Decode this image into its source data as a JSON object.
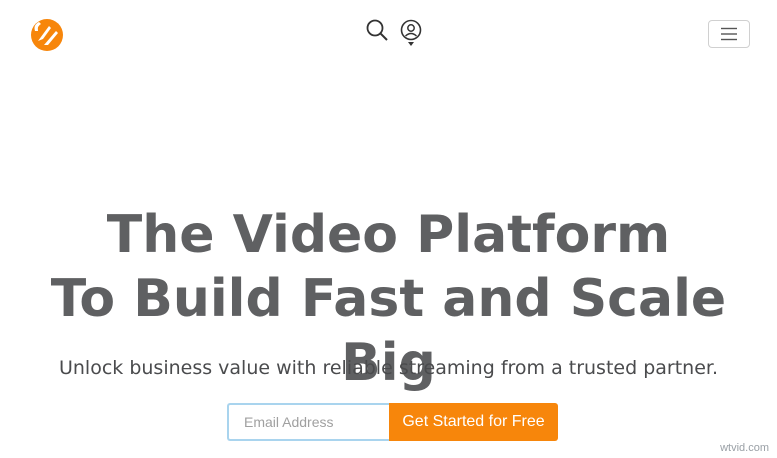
{
  "header": {
    "logo_icon": "orange-circle-logo-icon",
    "search_icon": "search-icon",
    "account_icon": "user-account-icon",
    "menu_icon": "hamburger-menu-icon"
  },
  "hero": {
    "title_line1": "The Video Platform",
    "title_line2": "To Build Fast and Scale Big",
    "subtitle": "Unlock business value with reliable streaming from a trusted partner."
  },
  "signup": {
    "email_placeholder": "Email Address",
    "email_value": "",
    "cta_label": "Get Started for Free"
  },
  "watermark": "wtvid.com",
  "colors": {
    "brand_orange": "#f7860b",
    "heading_gray": "#5f6062",
    "input_border": "#a9d4ee"
  }
}
